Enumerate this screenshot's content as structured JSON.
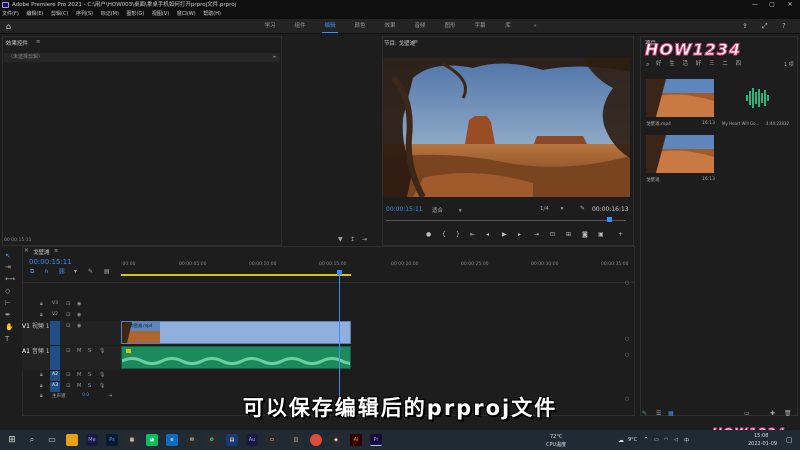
{
  "window": {
    "title": "Adobe Premiere Pro 2021 - C:\\用户\\HOW003\\桌面\\拿桌手机如何打开prproj文件.prproj",
    "icon": "premiere-icon"
  },
  "menu": [
    "文件(F)",
    "编辑(E)",
    "剪辑(C)",
    "序列(S)",
    "标记(M)",
    "图形(G)",
    "视图(V)",
    "窗口(W)",
    "帮助(H)"
  ],
  "workspaces": {
    "tabs": [
      "学习",
      "组件",
      "编辑",
      "颜色",
      "效果",
      "音频",
      "图形",
      "字幕",
      "库"
    ],
    "active": "编辑"
  },
  "effect_controls": {
    "title": "效果控件",
    "no_clip": "（未选择剪辑）",
    "timecode": "00:00:15:11"
  },
  "program_monitor": {
    "title": "节目: 戈壁滩",
    "timecode": "00:00:15:11",
    "fit": "适合",
    "ratio": "1/4",
    "duration": "00:00:16:13",
    "playhead_fraction": 0.93
  },
  "project": {
    "title": "项目",
    "count": "1 项",
    "items": [
      {
        "name": "戈壁滩.mp4",
        "duration": "16:13"
      },
      {
        "name": "My Heart Will Go...",
        "duration": "4:44:22832"
      },
      {
        "name": "戈壁滩",
        "duration": "16:13"
      }
    ]
  },
  "timeline": {
    "title": "戈壁滩",
    "timecode": "00:00:15:11",
    "ruler": [
      ":00:00",
      "00:00:05:00",
      "00:00:10:00",
      "00:00:15:00",
      "00:00:20:00",
      "00:00:25:00",
      "00:00:30:00",
      "00:00:35:00"
    ],
    "video_tracks": [
      "V3",
      "V2",
      "V1"
    ],
    "audio_tracks": [
      "A1",
      "A2",
      "A3"
    ],
    "v1_label": "视频 1",
    "a1_label": "音频 1",
    "master": "主声道",
    "master_value": "0.0",
    "clip_name": "戈壁滩.mp4",
    "clip_end_fraction": 0.45
  },
  "subtitle": "可以保存编辑后的prproj文件",
  "watermark": {
    "brand": "HOW1234",
    "slogan": "好 生 活 好 三 二 四"
  },
  "taskbar": {
    "weather_temp": "72°C",
    "weather_desc": "CPU温度",
    "tray_temp": "9°C",
    "time": "15:08",
    "date": "2022-01-09"
  }
}
